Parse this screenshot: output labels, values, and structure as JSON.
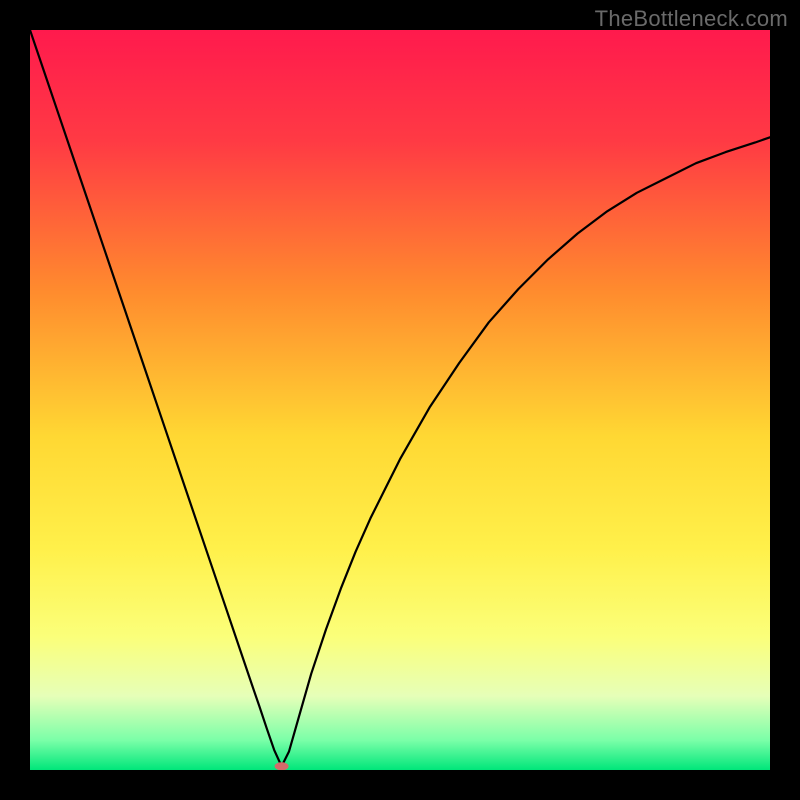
{
  "watermark": "TheBottleneck.com",
  "chart_data": {
    "type": "line",
    "title": "",
    "xlabel": "",
    "ylabel": "",
    "xlim": [
      0,
      100
    ],
    "ylim": [
      0,
      100
    ],
    "background": {
      "type": "vertical-gradient",
      "stops": [
        {
          "offset": 0.0,
          "color": "#ff1a4d"
        },
        {
          "offset": 0.15,
          "color": "#ff3a44"
        },
        {
          "offset": 0.35,
          "color": "#ff8a2e"
        },
        {
          "offset": 0.55,
          "color": "#ffd833"
        },
        {
          "offset": 0.7,
          "color": "#fff04a"
        },
        {
          "offset": 0.82,
          "color": "#fbff7a"
        },
        {
          "offset": 0.9,
          "color": "#e6ffb8"
        },
        {
          "offset": 0.96,
          "color": "#7affa8"
        },
        {
          "offset": 1.0,
          "color": "#00e67a"
        }
      ]
    },
    "curve": {
      "stroke": "#000000",
      "stroke_width": 2.2,
      "minimum_marker": {
        "x": 34,
        "y": 0.5,
        "color": "#d46a6a",
        "rx": 7,
        "ry": 4
      },
      "x": [
        0,
        2,
        4,
        6,
        8,
        10,
        12,
        14,
        16,
        18,
        20,
        22,
        24,
        26,
        28,
        30,
        31,
        32,
        33,
        34,
        35,
        36,
        37,
        38,
        40,
        42,
        44,
        46,
        48,
        50,
        54,
        58,
        62,
        66,
        70,
        74,
        78,
        82,
        86,
        90,
        94,
        98,
        100
      ],
      "y": [
        100,
        94.1,
        88.2,
        82.3,
        76.4,
        70.5,
        64.6,
        58.7,
        52.8,
        46.9,
        41,
        35.1,
        29.2,
        23.3,
        17.4,
        11.5,
        8.6,
        5.6,
        2.7,
        0.5,
        2.5,
        6,
        9.5,
        13,
        19,
        24.5,
        29.5,
        34,
        38,
        42,
        49,
        55,
        60.5,
        65,
        69,
        72.5,
        75.5,
        78,
        80,
        82,
        83.5,
        84.8,
        85.5
      ]
    }
  }
}
